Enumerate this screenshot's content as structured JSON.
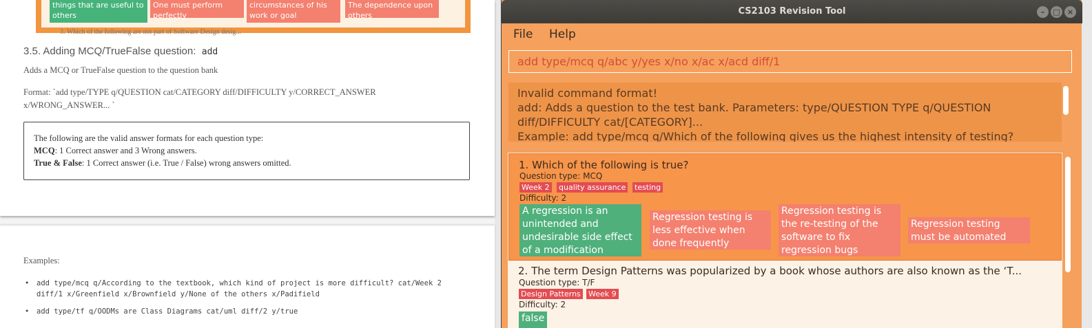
{
  "doc": {
    "prev_pills": [
      "things that are useful to others",
      "One must perform perfectly",
      "circumstances of his work or goal",
      "The dependence upon others"
    ],
    "prev_cut_text": "3. Which of the following are not part of Software Design desig...",
    "section_title": "3.5. Adding MCQ/TrueFalse question:",
    "section_code": "add",
    "desc": "Adds a MCQ or TrueFalse question to the question bank",
    "format_line1": "Format: `add type/TYPE q/QUESTION cat/CATEGORY diff/DIFFICULTY y/CORRECT_ANSWER",
    "format_line2": "x/WRONG_ANSWER... `",
    "box_intro": "The following are the valid answer formats for each question type:",
    "box_mcq_label": "MCQ",
    "box_mcq_text": ": 1 Correct answer and 3 Wrong answers.",
    "box_tf_label": "True & False",
    "box_tf_text": ": 1 Correct answer (i.e. True / False) wrong answers omitted.",
    "examples_label": "Examples:",
    "ex1_line1": "add type/mcq q/According to the textbook, which kind of project is more difficult? cat/Week 2",
    "ex1_line2": "diff/1 x/Greenfield x/Brownfield y/None of the others x/Padifield",
    "ex2_line1": "add type/tf q/OODMs are Class Diagrams cat/uml diff/2 y/true"
  },
  "app": {
    "title": "CS2103 Revision Tool",
    "menu": {
      "file": "File",
      "help": "Help"
    },
    "command_input": "add type/mcq q/abc y/yes x/no x/ac x/acd diff/1",
    "result_lines": [
      "Invalid command format!",
      "add: Adds a question to the test bank. Parameters: type/QUESTION TYPE q/QUESTION",
      "diff/DIFFICULTY cat/[CATEGORY]...",
      "Example: add type/mcq q/Which of the following gives us the highest intensity of testing?"
    ],
    "questions": [
      {
        "title": "1.  Which of the following is true?",
        "type": "Question type: MCQ",
        "tags": [
          "Week 2",
          "quality assurance",
          "testing"
        ],
        "difficulty": "Difficulty: 2",
        "answers": [
          {
            "text": "A regression is an unintended and undesirable side effect of a modification",
            "correct": true
          },
          {
            "text": "Regression testing is less effective when done frequently",
            "correct": false
          },
          {
            "text": "Regression testing is the re-testing of the software to fix regression bugs",
            "correct": false
          },
          {
            "text": "Regression testing must be automated",
            "correct": false
          }
        ]
      },
      {
        "title": "2.  The term Design Patterns was popularized by a book whose authors are also known as the ‘T...",
        "type": "Question type: T/F",
        "tags": [
          "Design Patterns",
          "Week 9"
        ],
        "difficulty": "Difficulty: 2",
        "answers": [
          {
            "text": "false",
            "correct": true
          }
        ]
      }
    ]
  },
  "colors": {
    "app_bg": "#f5a05c",
    "selected_card": "#f7954a",
    "correct": "#4fb07c",
    "wrong": "#f4806f",
    "tag": "#e34c52"
  }
}
